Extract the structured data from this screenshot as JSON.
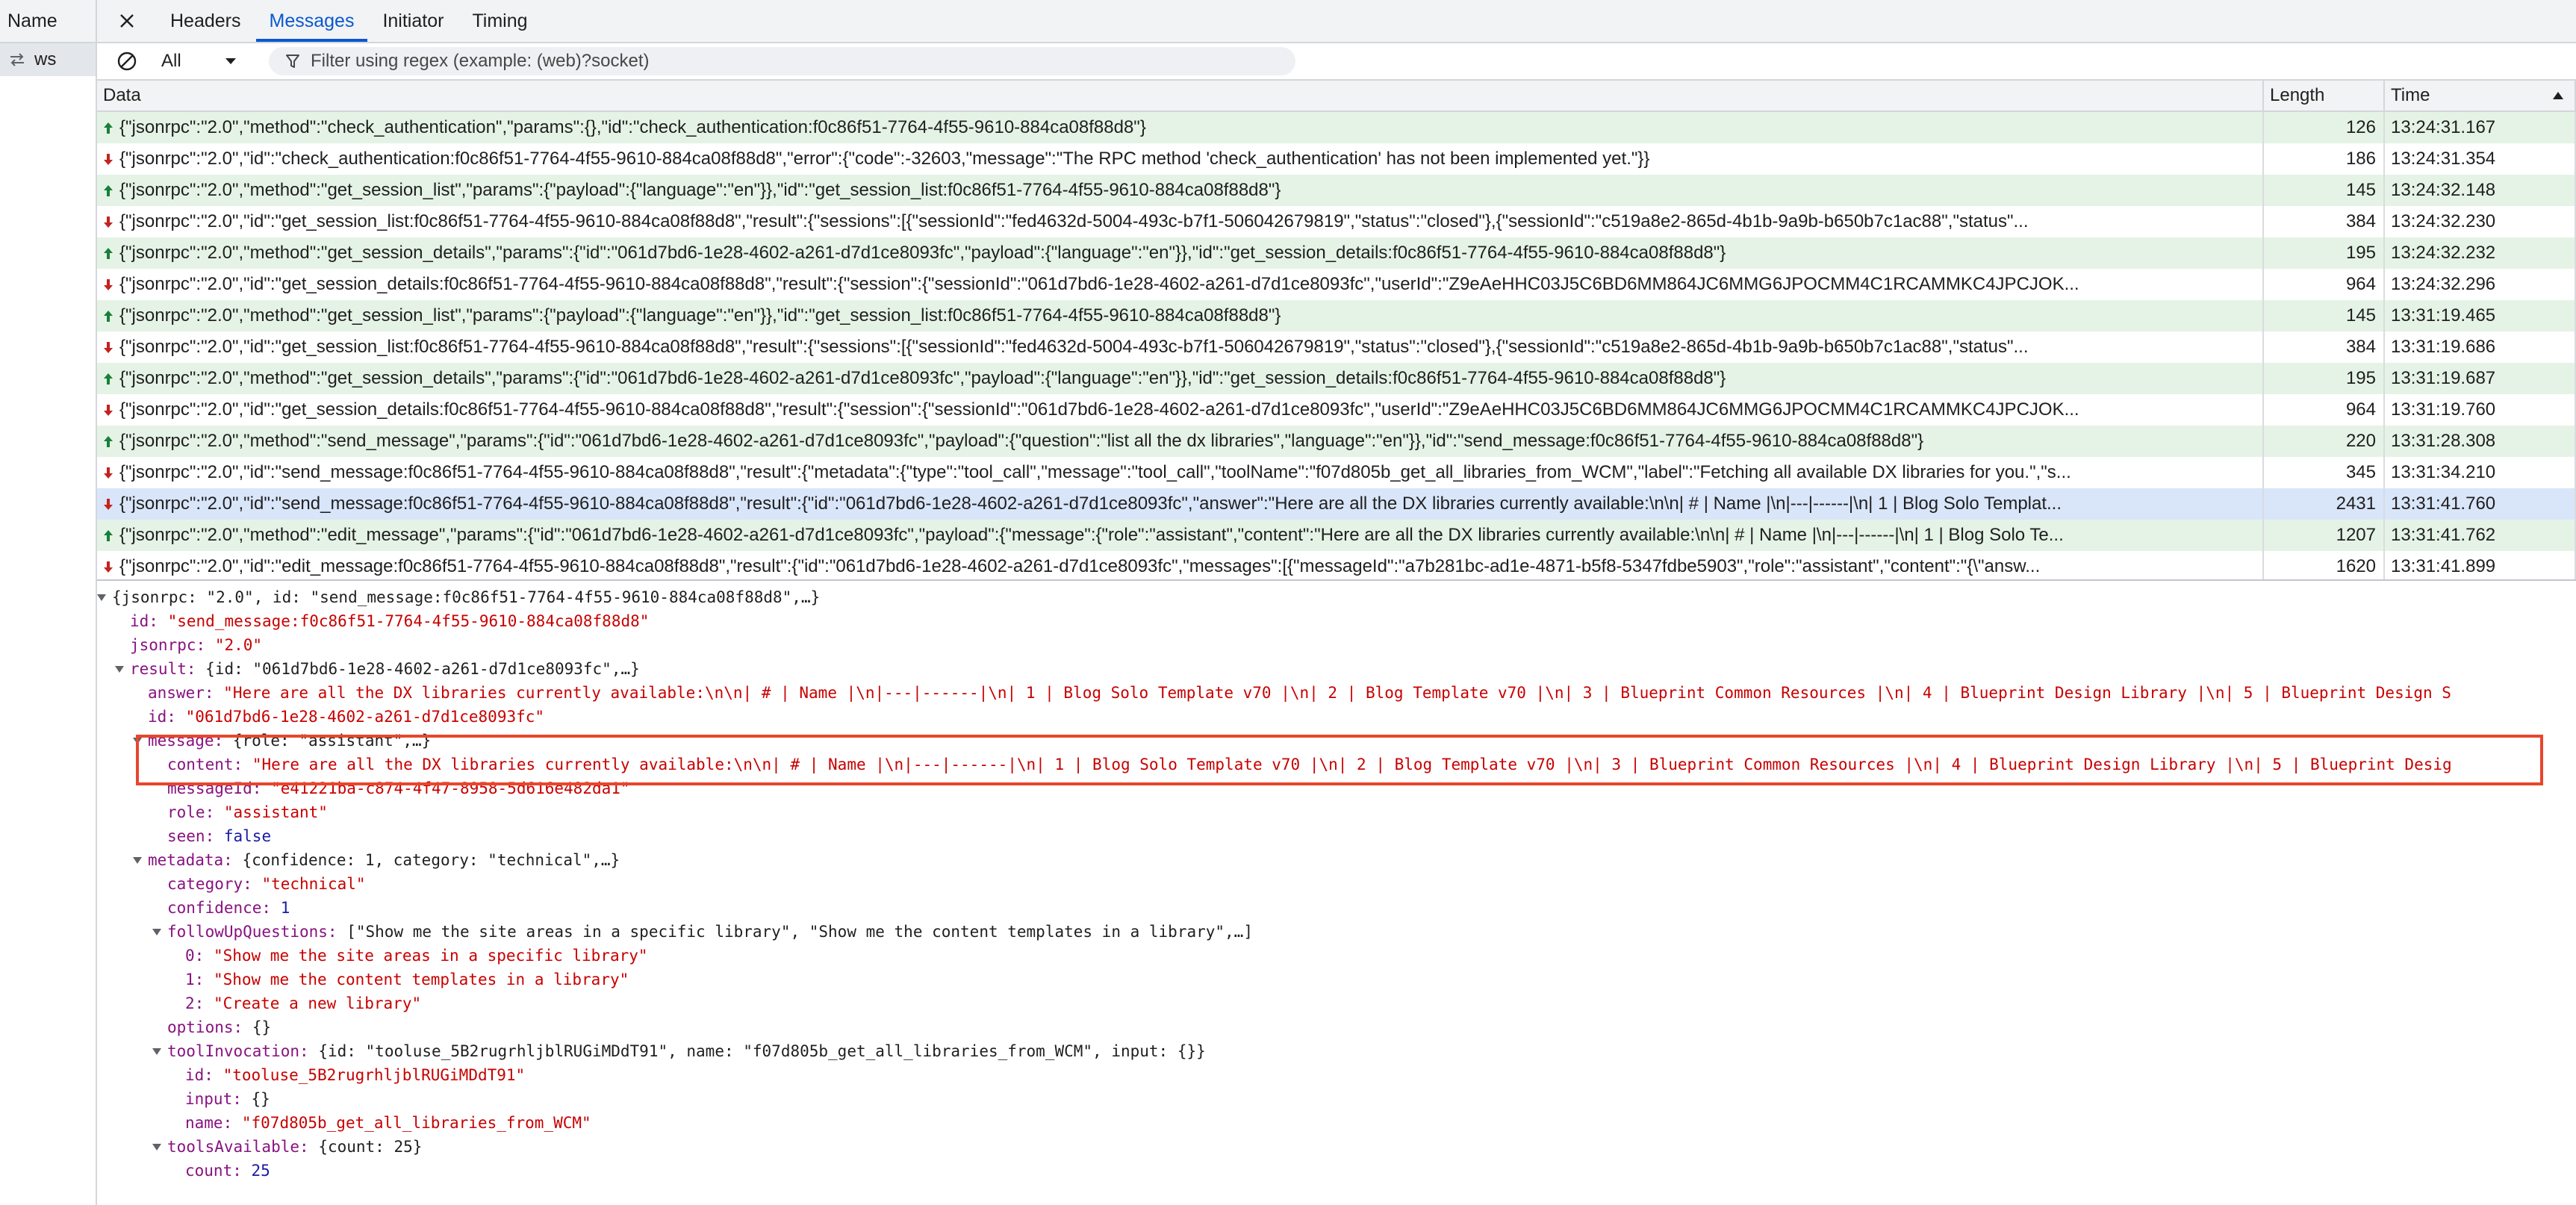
{
  "left_pane": {
    "header": "Name",
    "request_name": "ws"
  },
  "tabs": [
    "Headers",
    "Messages",
    "Initiator",
    "Timing"
  ],
  "active_tab": "Messages",
  "filter": {
    "type_value": "All",
    "placeholder": "Filter using regex (example: (web)?socket)"
  },
  "columns": {
    "data": "Data",
    "length": "Length",
    "time": "Time"
  },
  "colors": {
    "sent_row": "#e5f3e6",
    "selected_row": "#d9e5f9",
    "sent_arrow": "#188038",
    "received_arrow": "#c5221f",
    "accent": "#0b57d0",
    "highlight": "#e8462c"
  },
  "messages": [
    {
      "direction": "sent",
      "data": "{\"jsonrpc\":\"2.0\",\"method\":\"check_authentication\",\"params\":{},\"id\":\"check_authentication:f0c86f51-7764-4f55-9610-884ca08f88d8\"}",
      "length": "126",
      "time": "13:24:31.167"
    },
    {
      "direction": "received",
      "data": "{\"jsonrpc\":\"2.0\",\"id\":\"check_authentication:f0c86f51-7764-4f55-9610-884ca08f88d8\",\"error\":{\"code\":-32603,\"message\":\"The RPC method 'check_authentication' has not been implemented yet.\"}}",
      "length": "186",
      "time": "13:24:31.354"
    },
    {
      "direction": "sent",
      "data": "{\"jsonrpc\":\"2.0\",\"method\":\"get_session_list\",\"params\":{\"payload\":{\"language\":\"en\"}},\"id\":\"get_session_list:f0c86f51-7764-4f55-9610-884ca08f88d8\"}",
      "length": "145",
      "time": "13:24:32.148"
    },
    {
      "direction": "received",
      "data": "{\"jsonrpc\":\"2.0\",\"id\":\"get_session_list:f0c86f51-7764-4f55-9610-884ca08f88d8\",\"result\":{\"sessions\":[{\"sessionId\":\"fed4632d-5004-493c-b7f1-506042679819\",\"status\":\"closed\"},{\"sessionId\":\"c519a8e2-865d-4b1b-9a9b-b650b7c1ac88\",\"status\"...",
      "length": "384",
      "time": "13:24:32.230"
    },
    {
      "direction": "sent",
      "data": "{\"jsonrpc\":\"2.0\",\"method\":\"get_session_details\",\"params\":{\"id\":\"061d7bd6-1e28-4602-a261-d7d1ce8093fc\",\"payload\":{\"language\":\"en\"}},\"id\":\"get_session_details:f0c86f51-7764-4f55-9610-884ca08f88d8\"}",
      "length": "195",
      "time": "13:24:32.232"
    },
    {
      "direction": "received",
      "data": "{\"jsonrpc\":\"2.0\",\"id\":\"get_session_details:f0c86f51-7764-4f55-9610-884ca08f88d8\",\"result\":{\"session\":{\"sessionId\":\"061d7bd6-1e28-4602-a261-d7d1ce8093fc\",\"userId\":\"Z9eAeHHC03J5C6BD6MM864JC6MMG6JPOCMM4C1RCAMMKC4JPCJOK...",
      "length": "964",
      "time": "13:24:32.296"
    },
    {
      "direction": "sent",
      "data": "{\"jsonrpc\":\"2.0\",\"method\":\"get_session_list\",\"params\":{\"payload\":{\"language\":\"en\"}},\"id\":\"get_session_list:f0c86f51-7764-4f55-9610-884ca08f88d8\"}",
      "length": "145",
      "time": "13:31:19.465"
    },
    {
      "direction": "received",
      "data": "{\"jsonrpc\":\"2.0\",\"id\":\"get_session_list:f0c86f51-7764-4f55-9610-884ca08f88d8\",\"result\":{\"sessions\":[{\"sessionId\":\"fed4632d-5004-493c-b7f1-506042679819\",\"status\":\"closed\"},{\"sessionId\":\"c519a8e2-865d-4b1b-9a9b-b650b7c1ac88\",\"status\"...",
      "length": "384",
      "time": "13:31:19.686"
    },
    {
      "direction": "sent",
      "data": "{\"jsonrpc\":\"2.0\",\"method\":\"get_session_details\",\"params\":{\"id\":\"061d7bd6-1e28-4602-a261-d7d1ce8093fc\",\"payload\":{\"language\":\"en\"}},\"id\":\"get_session_details:f0c86f51-7764-4f55-9610-884ca08f88d8\"}",
      "length": "195",
      "time": "13:31:19.687"
    },
    {
      "direction": "received",
      "data": "{\"jsonrpc\":\"2.0\",\"id\":\"get_session_details:f0c86f51-7764-4f55-9610-884ca08f88d8\",\"result\":{\"session\":{\"sessionId\":\"061d7bd6-1e28-4602-a261-d7d1ce8093fc\",\"userId\":\"Z9eAeHHC03J5C6BD6MM864JC6MMG6JPOCMM4C1RCAMMKC4JPCJOK...",
      "length": "964",
      "time": "13:31:19.760"
    },
    {
      "direction": "sent",
      "data": "{\"jsonrpc\":\"2.0\",\"method\":\"send_message\",\"params\":{\"id\":\"061d7bd6-1e28-4602-a261-d7d1ce8093fc\",\"payload\":{\"question\":\"list all the dx libraries\",\"language\":\"en\"}},\"id\":\"send_message:f0c86f51-7764-4f55-9610-884ca08f88d8\"}",
      "length": "220",
      "time": "13:31:28.308"
    },
    {
      "direction": "received",
      "data": "{\"jsonrpc\":\"2.0\",\"id\":\"send_message:f0c86f51-7764-4f55-9610-884ca08f88d8\",\"result\":{\"metadata\":{\"type\":\"tool_call\",\"message\":\"tool_call\",\"toolName\":\"f07d805b_get_all_libraries_from_WCM\",\"label\":\"Fetching all available DX libraries for you.\",\"s...",
      "length": "345",
      "time": "13:31:34.210"
    },
    {
      "direction": "received",
      "selected": true,
      "data": "{\"jsonrpc\":\"2.0\",\"id\":\"send_message:f0c86f51-7764-4f55-9610-884ca08f88d8\",\"result\":{\"id\":\"061d7bd6-1e28-4602-a261-d7d1ce8093fc\",\"answer\":\"Here are all the DX libraries currently available:\\n\\n| # | Name |\\n|---|------|\\n| 1 | Blog Solo Templat...",
      "length": "2431",
      "time": "13:31:41.760"
    },
    {
      "direction": "sent",
      "data": "{\"jsonrpc\":\"2.0\",\"method\":\"edit_message\",\"params\":{\"id\":\"061d7bd6-1e28-4602-a261-d7d1ce8093fc\",\"payload\":{\"message\":{\"role\":\"assistant\",\"content\":\"Here are all the DX libraries currently available:\\n\\n| # | Name |\\n|---|------|\\n| 1 | Blog Solo Te...",
      "length": "1207",
      "time": "13:31:41.762"
    },
    {
      "direction": "received",
      "data": "{\"jsonrpc\":\"2.0\",\"id\":\"edit_message:f0c86f51-7764-4f55-9610-884ca08f88d8\",\"result\":{\"id\":\"061d7bd6-1e28-4602-a261-d7d1ce8093fc\",\"messages\":[{\"messageId\":\"a7b281bc-ad1e-4871-b5f8-5347fdbe5903\",\"role\":\"assistant\",\"content\":\"{\\\"answ...",
      "length": "1620",
      "time": "13:31:41.899"
    }
  ],
  "tree": {
    "root_summary": "{jsonrpc: \"2.0\", id: \"send_message:f0c86f51-7764-4f55-9610-884ca08f88d8\",…}",
    "id_key": "id:",
    "id_val": "\"send_message:f0c86f51-7764-4f55-9610-884ca08f88d8\"",
    "jsonrpc_key": "jsonrpc:",
    "jsonrpc_val": "\"2.0\"",
    "result_key": "result:",
    "result_summary": "{id: \"061d7bd6-1e28-4602-a261-d7d1ce8093fc\",…}",
    "answer_key": "answer:",
    "answer_val": "\"Here are all the DX libraries currently available:\\n\\n| # | Name |\\n|---|------|\\n| 1 | Blog Solo Template v70 |\\n| 2 | Blog Template v70 |\\n| 3 | Blueprint Common Resources |\\n| 4 | Blueprint Design Library |\\n| 5 | Blueprint Design S",
    "result_id_key": "id:",
    "result_id_val": "\"061d7bd6-1e28-4602-a261-d7d1ce8093fc\"",
    "message_key": "message:",
    "message_summary": "{role: \"assistant\",…}",
    "content_key": "content:",
    "content_val": "\"Here are all the DX libraries currently available:\\n\\n| # | Name |\\n|---|------|\\n| 1 | Blog Solo Template v70 |\\n| 2 | Blog Template v70 |\\n| 3 | Blueprint Common Resources |\\n| 4 | Blueprint Design Library |\\n| 5 | Blueprint Desig",
    "messageid_key": "messageId:",
    "messageid_val": "\"e41221ba-c874-4f47-8958-5d616e482da1\"",
    "role_key": "role:",
    "role_val": "\"assistant\"",
    "seen_key": "seen:",
    "seen_val": "false",
    "metadata_key": "metadata:",
    "metadata_summary": "{confidence: 1, category: \"technical\",…}",
    "category_key": "category:",
    "category_val": "\"technical\"",
    "confidence_key": "confidence:",
    "confidence_val": "1",
    "followup_key": "followUpQuestions:",
    "followup_summary": "[\"Show me the site areas in a specific library\", \"Show me the content templates in a library\",…]",
    "fq0_key": "0:",
    "fq0_val": "\"Show me the site areas in a specific library\"",
    "fq1_key": "1:",
    "fq1_val": "\"Show me the content templates in a library\"",
    "fq2_key": "2:",
    "fq2_val": "\"Create a new library\"",
    "options_key": "options:",
    "options_val": "{}",
    "toolinv_key": "toolInvocation:",
    "toolinv_summary": "{id: \"tooluse_5B2rugrhljblRUGiMDdT91\", name: \"f07d805b_get_all_libraries_from_WCM\", input: {}}",
    "ti_id_key": "id:",
    "ti_id_val": "\"tooluse_5B2rugrhljblRUGiMDdT91\"",
    "ti_input_key": "input:",
    "ti_input_val": "{}",
    "ti_name_key": "name:",
    "ti_name_val": "\"f07d805b_get_all_libraries_from_WCM\"",
    "tools_key": "toolsAvailable:",
    "tools_summary": "{count: 25}",
    "count_key": "count:",
    "count_val": "25"
  }
}
